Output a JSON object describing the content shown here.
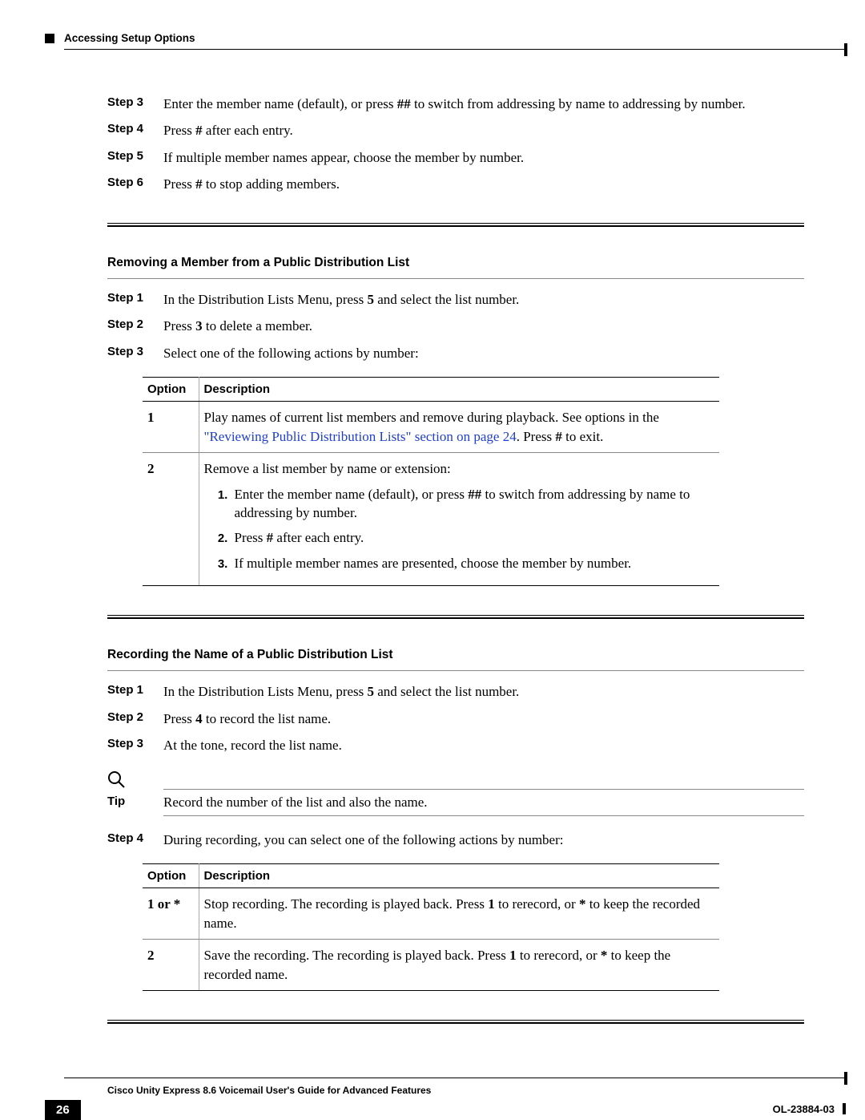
{
  "header": {
    "section": "Accessing Setup Options"
  },
  "block1": {
    "steps": [
      {
        "label": "Step 3",
        "pre": "Enter the member name (default), or press ",
        "key": "##",
        "post": " to switch from addressing by name to addressing by number."
      },
      {
        "label": "Step 4",
        "pre": "Press ",
        "key": "#",
        "post": " after each entry."
      },
      {
        "label": "Step 5",
        "text": "If multiple member names appear, choose the member by number."
      },
      {
        "label": "Step 6",
        "pre": "Press ",
        "key": "#",
        "post": " to stop adding members."
      }
    ]
  },
  "section2": {
    "title": "Removing a Member from a Public Distribution List",
    "steps": [
      {
        "label": "Step 1",
        "pre": "In the Distribution Lists Menu, press ",
        "key": "5",
        "post": " and select the list number."
      },
      {
        "label": "Step 2",
        "pre": "Press ",
        "key": "3",
        "post": " to delete a member."
      },
      {
        "label": "Step 3",
        "text": "Select one of the following actions by number:"
      }
    ],
    "table": {
      "col1": "Option",
      "col2": "Description",
      "rows": [
        {
          "opt": "1",
          "desc_pre": "Play names of current list members and remove during playback. See options in the ",
          "link": "\"Reviewing Public Distribution Lists\" section on page 24",
          "desc_post1": ". Press ",
          "desc_key": "#",
          "desc_post2": " to exit."
        },
        {
          "opt": "2",
          "lead": "Remove a list member by name or extension:",
          "items": [
            {
              "pre": "Enter the member name (default), or press ",
              "key": "##",
              "post": " to switch from addressing by name to addressing by number."
            },
            {
              "pre": "Press ",
              "key": "#",
              "post": " after each entry."
            },
            {
              "text": "If multiple member names are presented, choose the member by number."
            }
          ]
        }
      ]
    }
  },
  "section3": {
    "title": "Recording the Name of a Public Distribution List",
    "steps_a": [
      {
        "label": "Step 1",
        "pre": "In the Distribution Lists Menu, press ",
        "key": "5",
        "post": " and select the list number."
      },
      {
        "label": "Step 2",
        "pre": "Press ",
        "key": "4",
        "post": " to record the list name."
      },
      {
        "label": "Step 3",
        "text": "At the tone, record the list name."
      }
    ],
    "tip": {
      "label": "Tip",
      "text": "Record the number of the list and also the name."
    },
    "steps_b": [
      {
        "label": "Step 4",
        "text": "During recording, you can select one of the following actions by number:"
      }
    ],
    "table": {
      "col1": "Option",
      "col2": "Description",
      "rows": [
        {
          "opt": "1 or *",
          "p1": "Stop recording. The recording is played back. Press ",
          "k1": "1",
          "p2": " to rerecord, or ",
          "k2": "*",
          "p3": " to keep the recorded name."
        },
        {
          "opt": "2",
          "p1": "Save the recording. The recording is played back. Press ",
          "k1": "1",
          "p2": " to rerecord, or ",
          "k2": "*",
          "p3": " to keep the recorded name."
        }
      ]
    }
  },
  "footer": {
    "title": "Cisco Unity Express 8.6 Voicemail User's Guide for Advanced Features",
    "page": "26",
    "docid": "OL-23884-03"
  }
}
